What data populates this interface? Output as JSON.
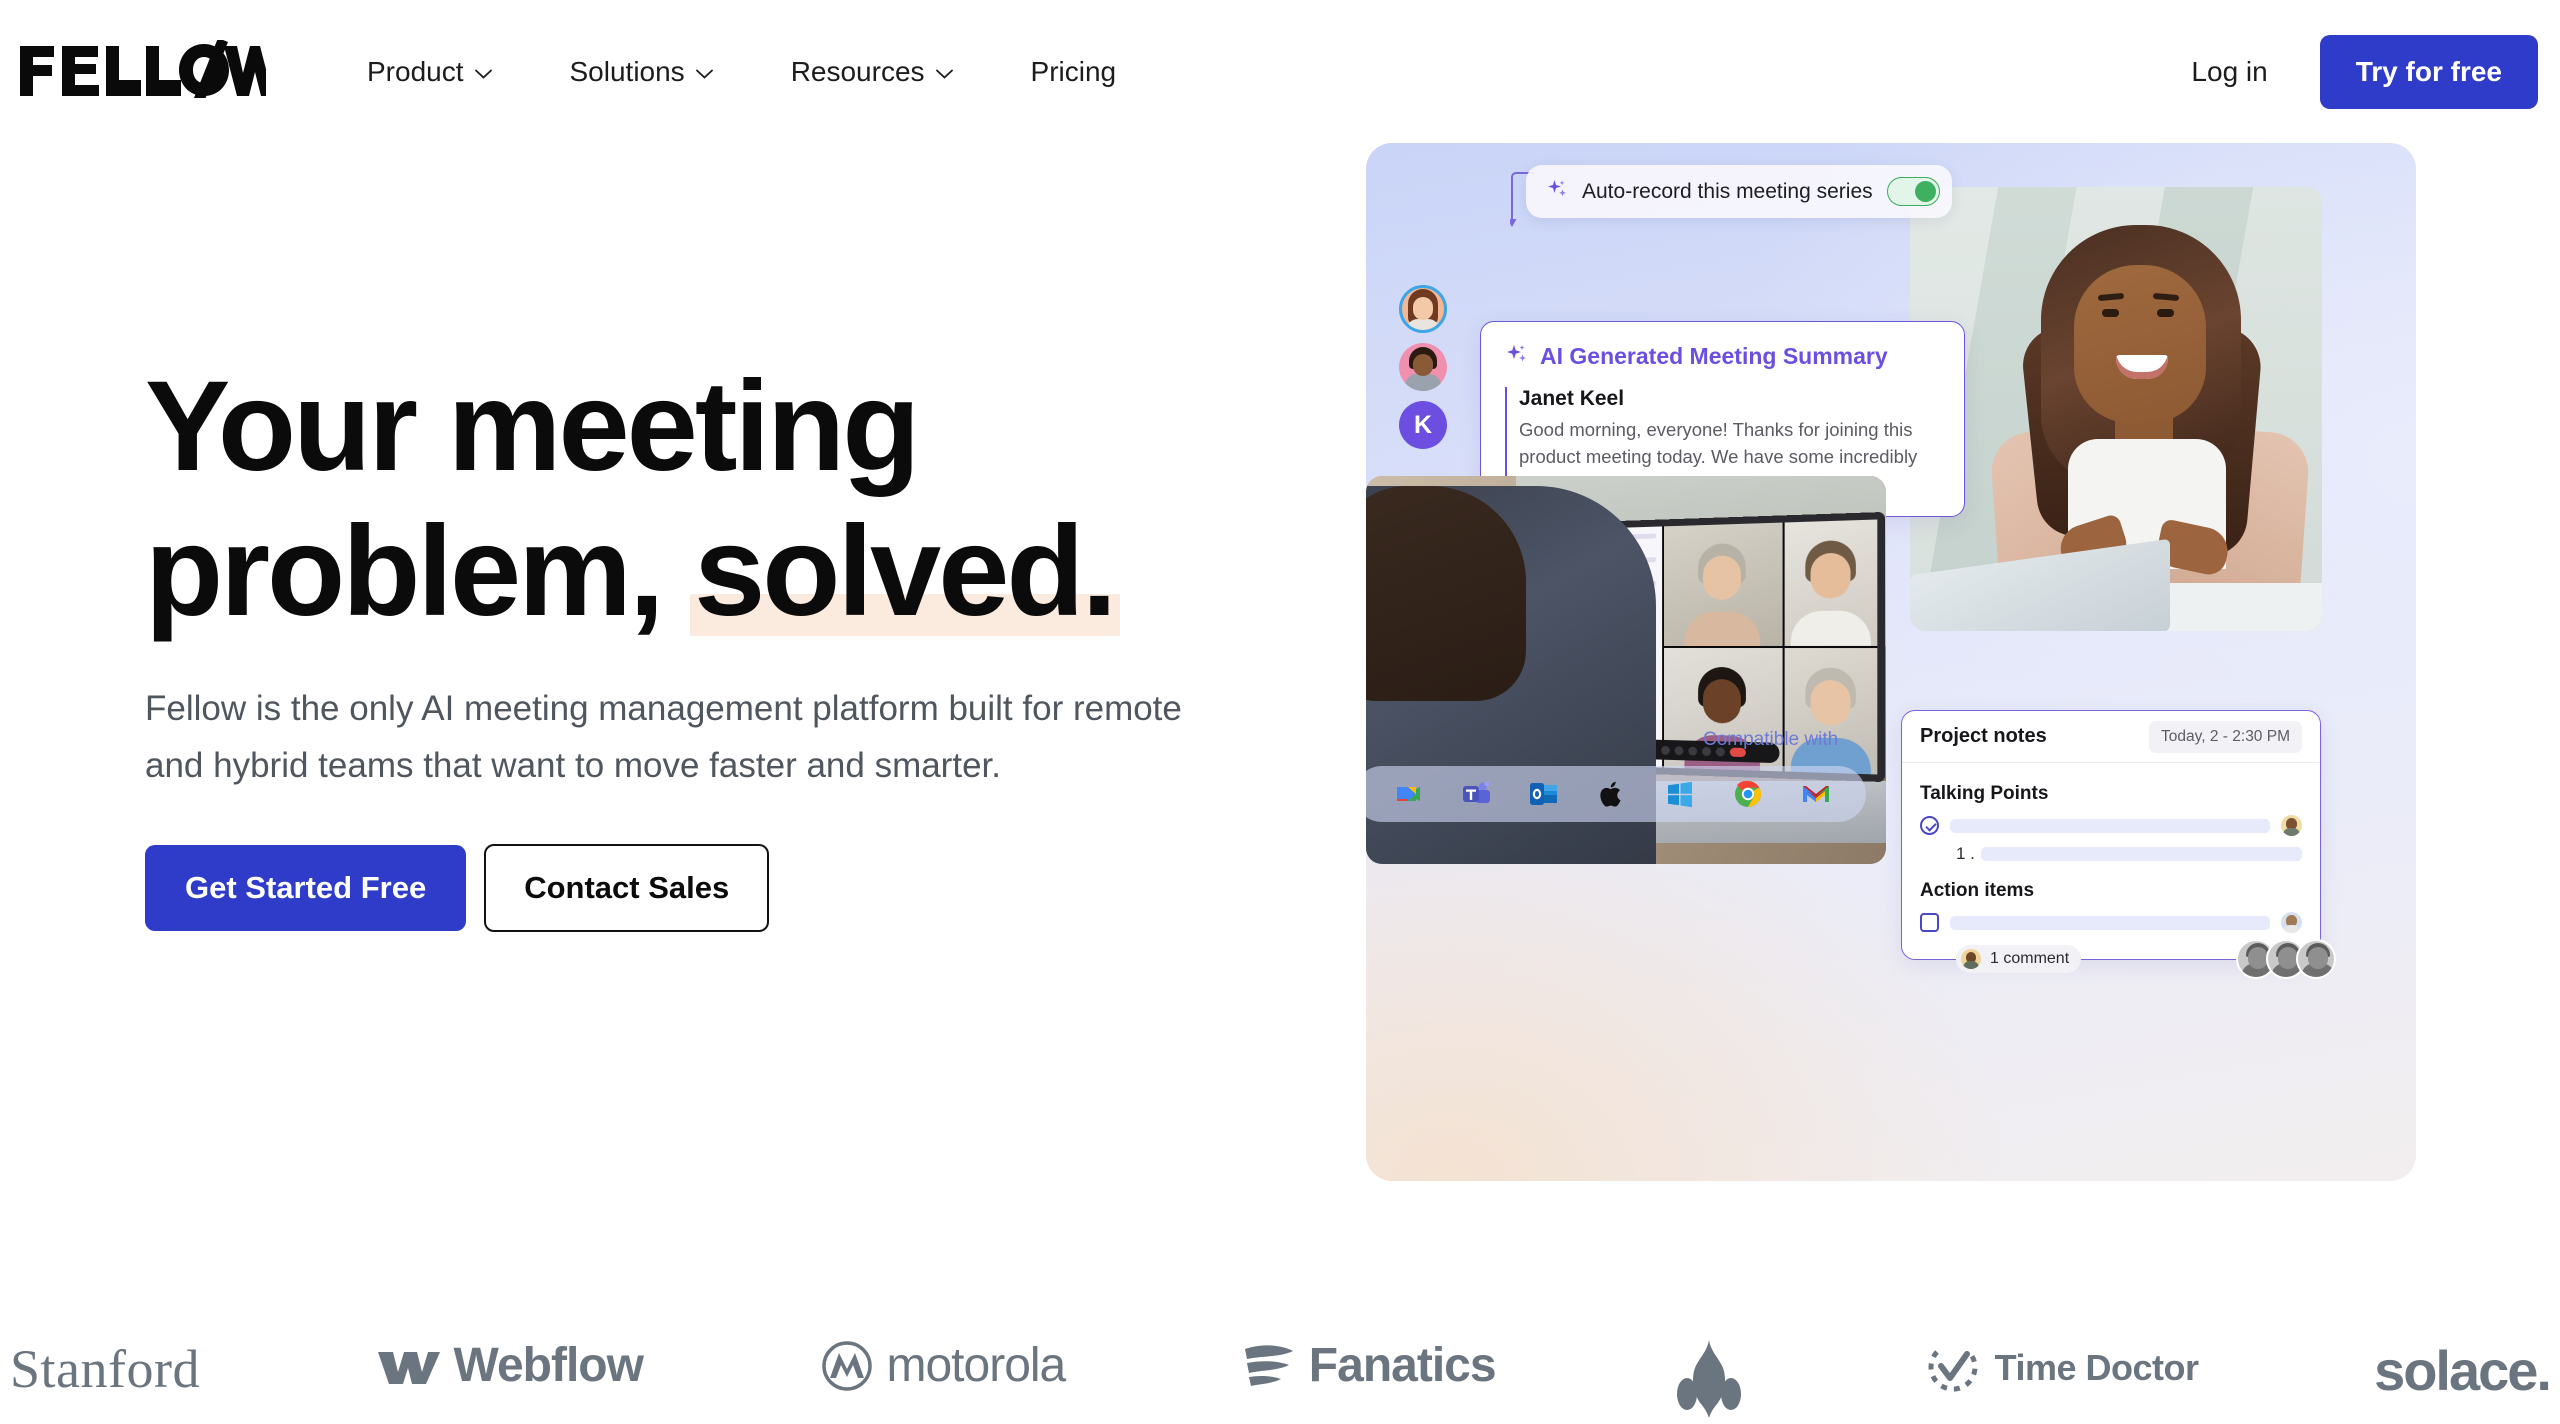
{
  "brand": {
    "name": "FELLOW",
    "accent_blue": "#2f3bc9",
    "accent_purple": "#6b4fe0"
  },
  "header": {
    "nav": [
      {
        "label": "Product",
        "has_chevron": true,
        "icon": "chevron-down-icon"
      },
      {
        "label": "Solutions",
        "has_chevron": true,
        "icon": "chevron-down-icon"
      },
      {
        "label": "Resources",
        "has_chevron": true,
        "icon": "chevron-down-icon"
      },
      {
        "label": "Pricing",
        "has_chevron": false,
        "icon": ""
      }
    ],
    "login_label": "Log in",
    "cta_label": "Try for free"
  },
  "hero": {
    "headline_line1": "Your meeting",
    "headline_line2_pre": "problem, ",
    "headline_line2_highlight": "solved.",
    "subhead": "Fellow is the only AI meeting management platform built for remote and hybrid teams that want to move faster and smarter.",
    "primary_cta": "Get Started Free",
    "secondary_cta": "Contact Sales"
  },
  "hero_visual": {
    "auto_record": {
      "label": "Auto-record this meeting series",
      "sparkle_icon": "sparkle-icon",
      "toggle_state": "on",
      "toggle_color": "#3eb160"
    },
    "avatars": [
      {
        "name": "avatar-woman",
        "initial": ""
      },
      {
        "name": "avatar-man",
        "initial": ""
      },
      {
        "name": "avatar-initial",
        "initial": "K"
      }
    ],
    "ai_summary": {
      "sparkle_icon": "sparkle-icon",
      "title": "AI Generated Meeting Summary",
      "speaker": "Janet Keel",
      "body": "Good morning, everyone! Thanks for joining this product meeting today. We have some incredibly exciting updates to share. Let's dive right in!"
    },
    "compatible": {
      "label": "Compatible with",
      "apps": [
        "zoom-icon",
        "google-meet-icon",
        "microsoft-teams-icon",
        "outlook-icon",
        "apple-icon",
        "windows-icon",
        "chrome-icon",
        "gmail-icon"
      ]
    },
    "project_notes": {
      "title": "Project notes",
      "time": "Today, 2 - 2:30 PM",
      "sections": [
        {
          "title": "Talking Points",
          "checkbox_style": "round-checked",
          "sub_number": "1 ."
        },
        {
          "title": "Action items",
          "checkbox_style": "square-unchecked",
          "comment_label": "1 comment"
        }
      ]
    }
  },
  "logos": [
    {
      "name": "stanford",
      "text": "Stanford",
      "style": "serif"
    },
    {
      "name": "webflow",
      "text": "Webflow",
      "style": "mark-text"
    },
    {
      "name": "motorola",
      "text": "motorola",
      "style": "mark-text"
    },
    {
      "name": "fanatics",
      "text": "Fanatics",
      "style": "mark-text"
    },
    {
      "name": "mascot",
      "text": "",
      "style": "mark-only"
    },
    {
      "name": "time-doctor",
      "text": "Time Doctor",
      "style": "mark-text"
    },
    {
      "name": "solace",
      "text": "solace.",
      "style": "text"
    }
  ]
}
